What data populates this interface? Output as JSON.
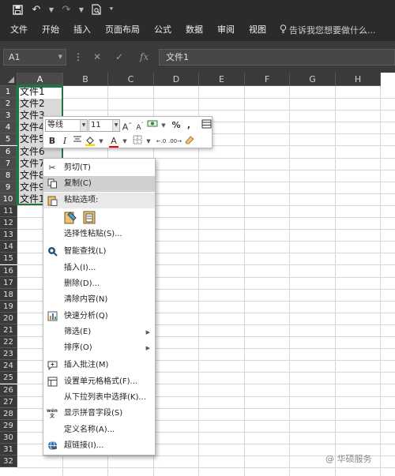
{
  "qat": {
    "save": "🖫",
    "undo": "↶",
    "redo": "↷",
    "print_preview": "🗋"
  },
  "ribbon": {
    "tabs": [
      "文件",
      "开始",
      "插入",
      "页面布局",
      "公式",
      "数据",
      "审阅",
      "视图"
    ],
    "tellme": "告诉我您想要做什么..."
  },
  "formula_bar": {
    "name_box": "A1",
    "fx": "fx",
    "value": "文件1"
  },
  "grid": {
    "columns": [
      "A",
      "B",
      "C",
      "D",
      "E",
      "F",
      "G",
      "H"
    ],
    "rows": [
      "1",
      "2",
      "3",
      "4",
      "5",
      "6",
      "7",
      "8",
      "9",
      "10",
      "11",
      "12",
      "13",
      "14",
      "15",
      "16",
      "17",
      "18",
      "19",
      "20",
      "21",
      "22",
      "23",
      "24",
      "25",
      "26",
      "27",
      "28",
      "29",
      "30",
      "31",
      "32"
    ],
    "cells": [
      "文件1",
      "文件2",
      "文件3",
      "文件4",
      "文件5",
      "文件6",
      "文件7",
      "文件8",
      "文件9",
      "文件10"
    ]
  },
  "mini_toolbar": {
    "font": "等线",
    "size": "11"
  },
  "context_menu": {
    "cut": "剪切(T)",
    "copy": "复制(C)",
    "paste_options": "粘贴选项:",
    "paste_special": "选择性粘贴(S)...",
    "smart_lookup": "智能查找(L)",
    "insert": "插入(I)...",
    "delete": "删除(D)...",
    "clear": "清除内容(N)",
    "quick_analysis": "快速分析(Q)",
    "filter": "筛选(E)",
    "sort": "排序(O)",
    "insert_comment": "插入批注(M)",
    "format_cells": "设置单元格格式(F)...",
    "pick_list": "从下拉列表中选择(K)...",
    "phonetic": "显示拼音字段(S)",
    "define_name": "定义名称(A)...",
    "hyperlink": "超链接(I)..."
  },
  "watermark": "@ 华硕服务"
}
